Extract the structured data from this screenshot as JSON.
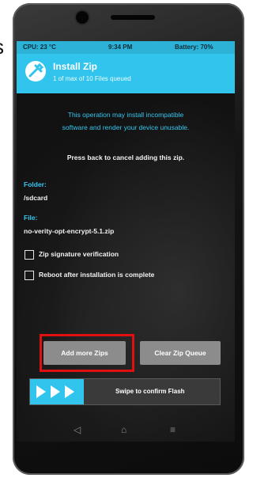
{
  "status_bar": {
    "cpu": "CPU: 23 °C",
    "time": "9:34 PM",
    "battery": "Battery: 70%"
  },
  "header": {
    "title": "Install Zip",
    "subtitle": "1 of max of 10 Files queued",
    "logo_icon": "twrp-logo-icon"
  },
  "warning": {
    "line1": "This operation may install incompatible",
    "line2": "software and render your device unusable."
  },
  "cancel_hint": "Press back to cancel adding this zip.",
  "folder": {
    "label": "Folder:",
    "value": "/sdcard"
  },
  "file": {
    "label": "File:",
    "value": "no-verity-opt-encrypt-5.1.zip"
  },
  "options": [
    {
      "label": "Zip signature verification",
      "checked": false
    },
    {
      "label": "Reboot after installation is complete",
      "checked": false
    }
  ],
  "buttons": {
    "add_more": "Add more Zips",
    "clear_queue": "Clear Zip Queue"
  },
  "swipe": {
    "label": "Swipe to confirm Flash"
  },
  "nav": {
    "back": "◁",
    "home": "⌂",
    "recents": "≡"
  },
  "colors": {
    "accent": "#31c4ec",
    "highlight": "#e01010",
    "button": "#8c8c8c"
  },
  "side_text": "s"
}
